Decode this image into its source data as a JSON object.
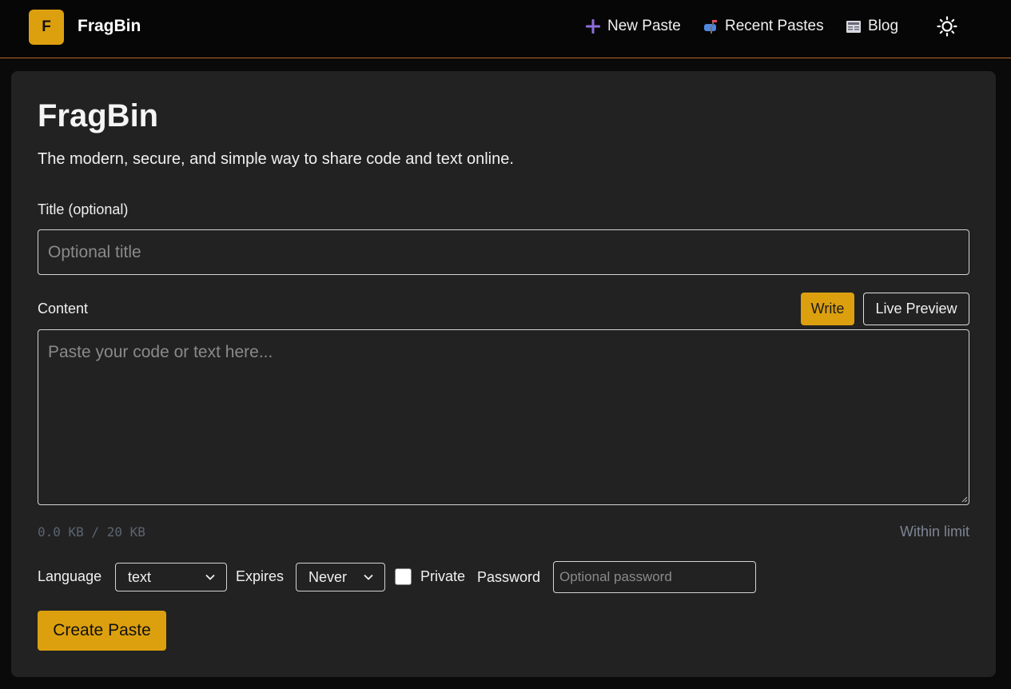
{
  "header": {
    "logo_letter": "F",
    "brand": "FragBin",
    "nav": [
      {
        "label": "New Paste",
        "icon": "plus-icon"
      },
      {
        "label": "Recent Pastes",
        "icon": "mailbox-icon"
      },
      {
        "label": "Blog",
        "icon": "newspaper-icon"
      }
    ],
    "theme_toggle_icon": "sun-icon"
  },
  "main": {
    "title": "FragBin",
    "subtitle": "The modern, secure, and simple way to share code and text online.",
    "title_field": {
      "label": "Title (optional)",
      "placeholder": "Optional title",
      "value": ""
    },
    "content_field": {
      "label": "Content",
      "placeholder": "Paste your code or text here...",
      "value": "",
      "write_label": "Write",
      "preview_label": "Live Preview"
    },
    "size": {
      "count": "0.0 KB / 20 KB",
      "status": "Within limit"
    },
    "options": {
      "language_label": "Language",
      "language_value": "text",
      "expires_label": "Expires",
      "expires_value": "Never",
      "private_label": "Private",
      "private_checked": false,
      "password_label": "Password",
      "password_placeholder": "Optional password"
    },
    "submit_label": "Create Paste"
  },
  "colors": {
    "accent": "#dca00f",
    "header_border": "#b06a2a",
    "card_bg": "#222222",
    "page_bg": "#0a0a0a"
  }
}
